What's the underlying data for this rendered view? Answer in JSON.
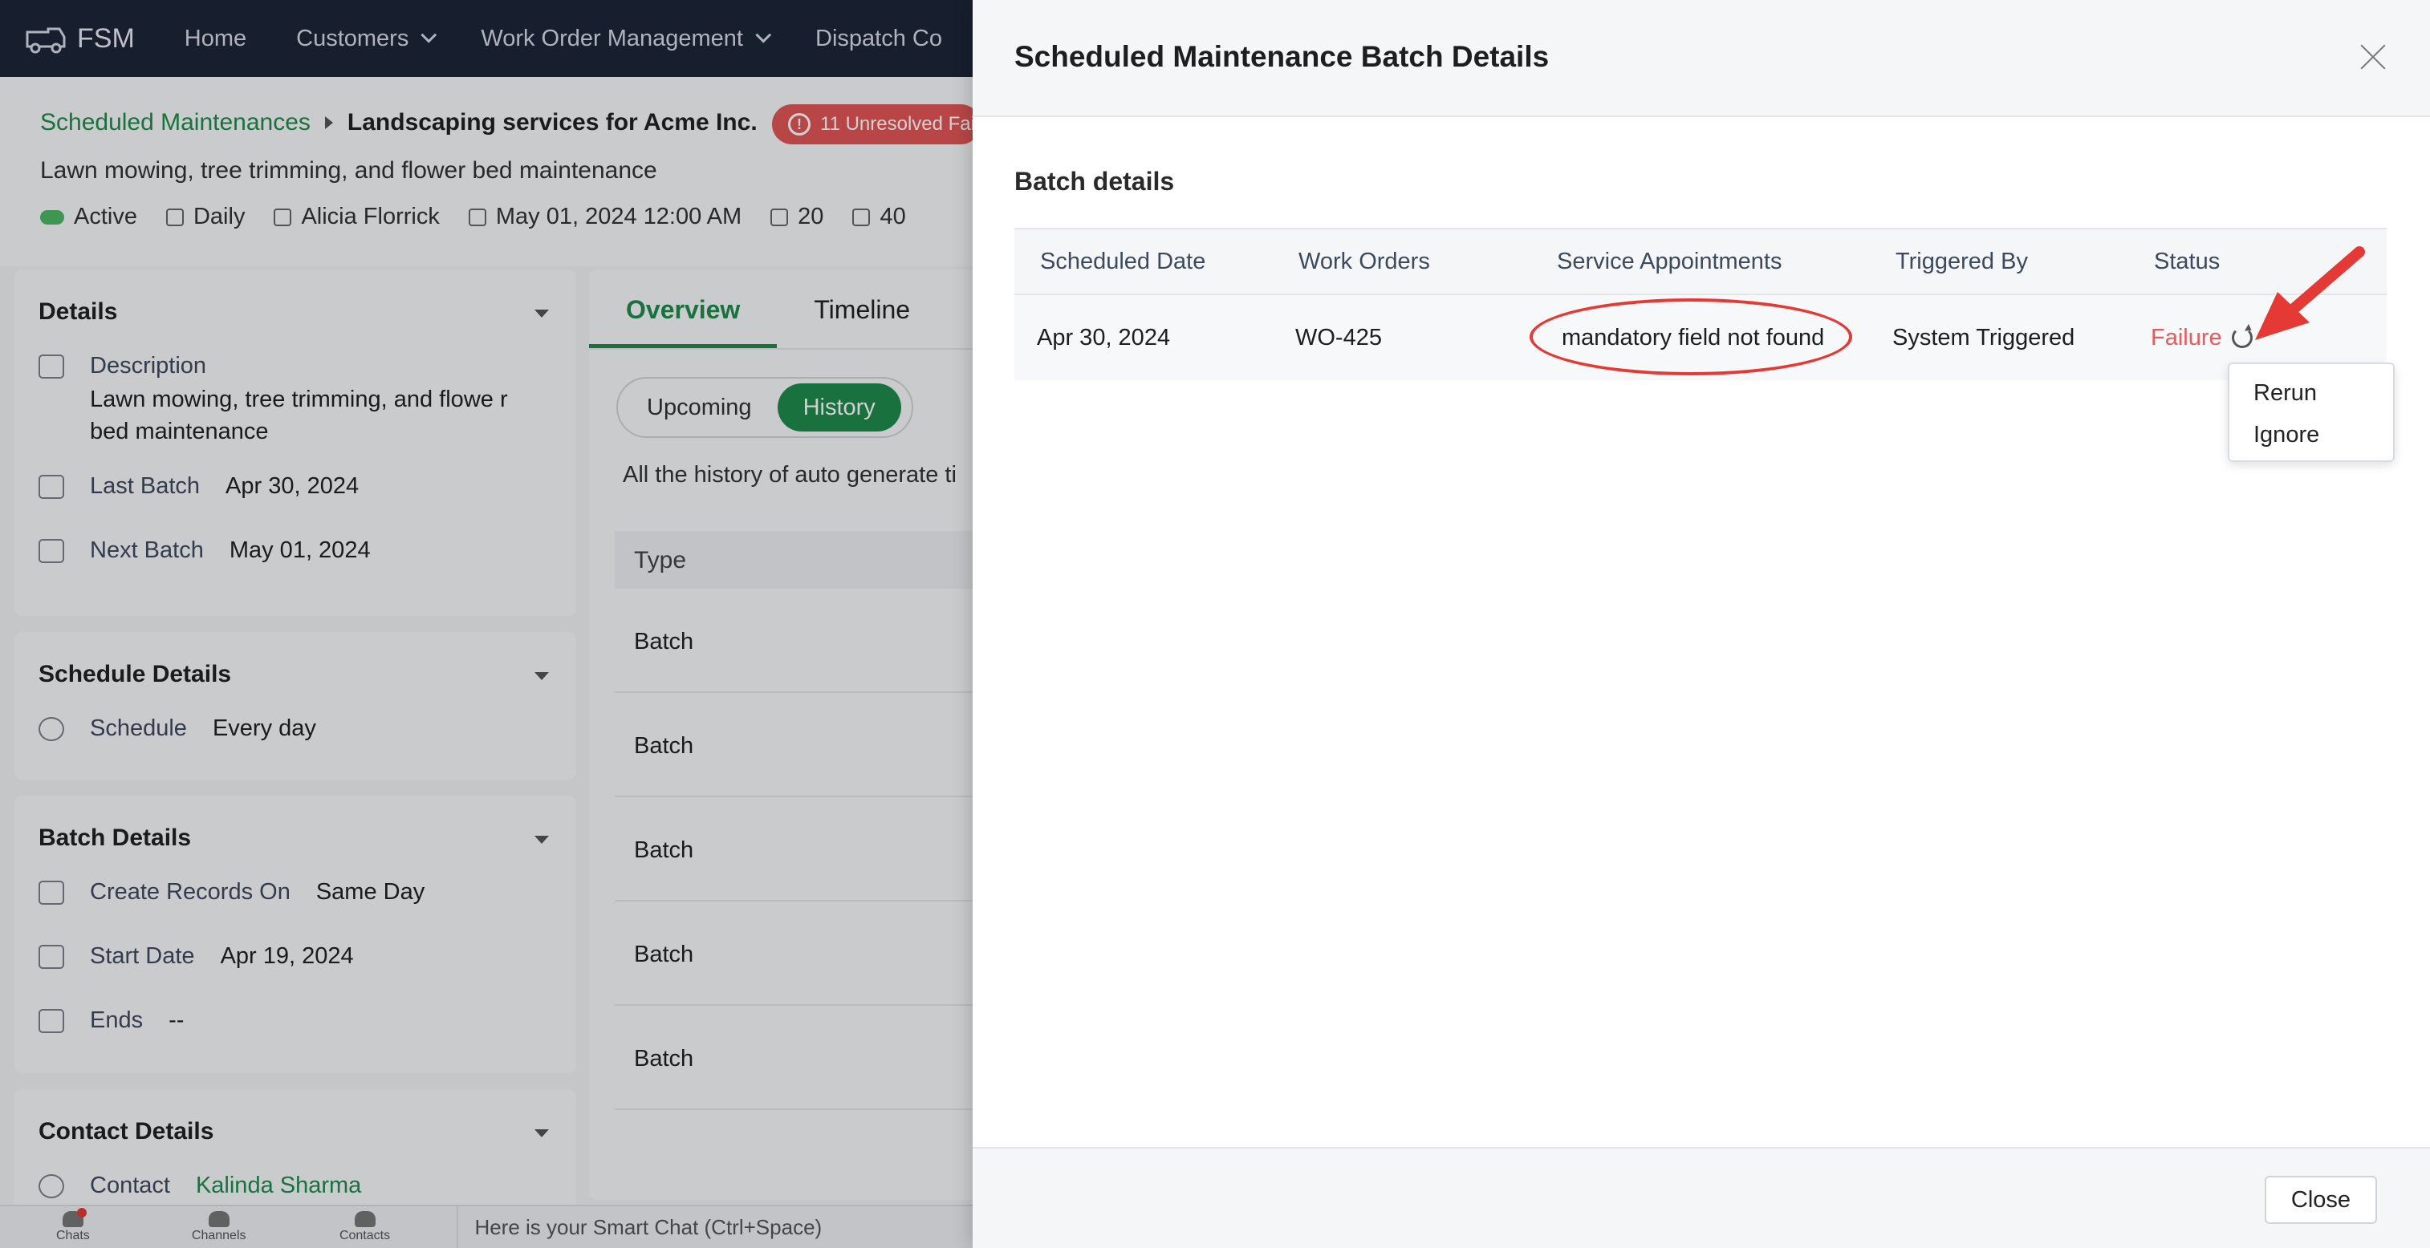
{
  "app": {
    "logo_text": "FSM",
    "nav": [
      "Home",
      "Customers",
      "Work Order Management",
      "Dispatch Co"
    ]
  },
  "header": {
    "breadcrumb_link": "Scheduled Maintenances",
    "title": "Landscaping services for Acme Inc.",
    "failure_badge": "11 Unresolved Fai",
    "subtitle": "Lawn mowing, tree trimming, and flower bed maintenance",
    "meta": {
      "status": "Active",
      "frequency": "Daily",
      "owner": "Alicia Florrick",
      "start": "May 01, 2024 12:00 AM",
      "count_a": "20",
      "count_b": "40"
    }
  },
  "details_card": {
    "title": "Details",
    "description_label": "Description",
    "description_value": "Lawn mowing, tree trimming, and flowe r bed maintenance",
    "last_batch_label": "Last Batch",
    "last_batch_value": "Apr 30, 2024",
    "next_batch_label": "Next Batch",
    "next_batch_value": "May 01, 2024"
  },
  "schedule_card": {
    "title": "Schedule Details",
    "schedule_label": "Schedule",
    "schedule_value": "Every day"
  },
  "batch_card": {
    "title": "Batch Details",
    "create_label": "Create Records On",
    "create_value": "Same Day",
    "start_label": "Start Date",
    "start_value": "Apr 19, 2024",
    "ends_label": "Ends",
    "ends_value": "--"
  },
  "contact_card": {
    "title": "Contact Details",
    "contact_label": "Contact",
    "contact_value": "Kalinda Sharma"
  },
  "middle": {
    "tabs": [
      "Overview",
      "Timeline"
    ],
    "toggle": [
      "Upcoming",
      "History"
    ],
    "note": "All the history of auto generate ti",
    "table_header": "Type",
    "rows": [
      "Batch",
      "Batch",
      "Batch",
      "Batch",
      "Batch"
    ]
  },
  "bottom_bar": {
    "items": [
      "Chats",
      "Channels",
      "Contacts"
    ],
    "smart_chat": "Here is your Smart Chat (Ctrl+Space)"
  },
  "modal": {
    "title": "Scheduled Maintenance Batch Details",
    "section_title": "Batch details",
    "columns": [
      "Scheduled Date",
      "Work Orders",
      "Service Appointments",
      "Triggered By",
      "Status"
    ],
    "row": {
      "scheduled_date": "Apr 30, 2024",
      "work_order": "WO-425",
      "service_appointments": "mandatory field not found",
      "triggered_by": "System Triggered",
      "status": "Failure"
    },
    "dropdown": [
      "Rerun",
      "Ignore"
    ],
    "close_label": "Close",
    "colors": {
      "failure": "#e65b5b",
      "annotation": "#e53935",
      "accent": "#1f8a4c"
    }
  }
}
